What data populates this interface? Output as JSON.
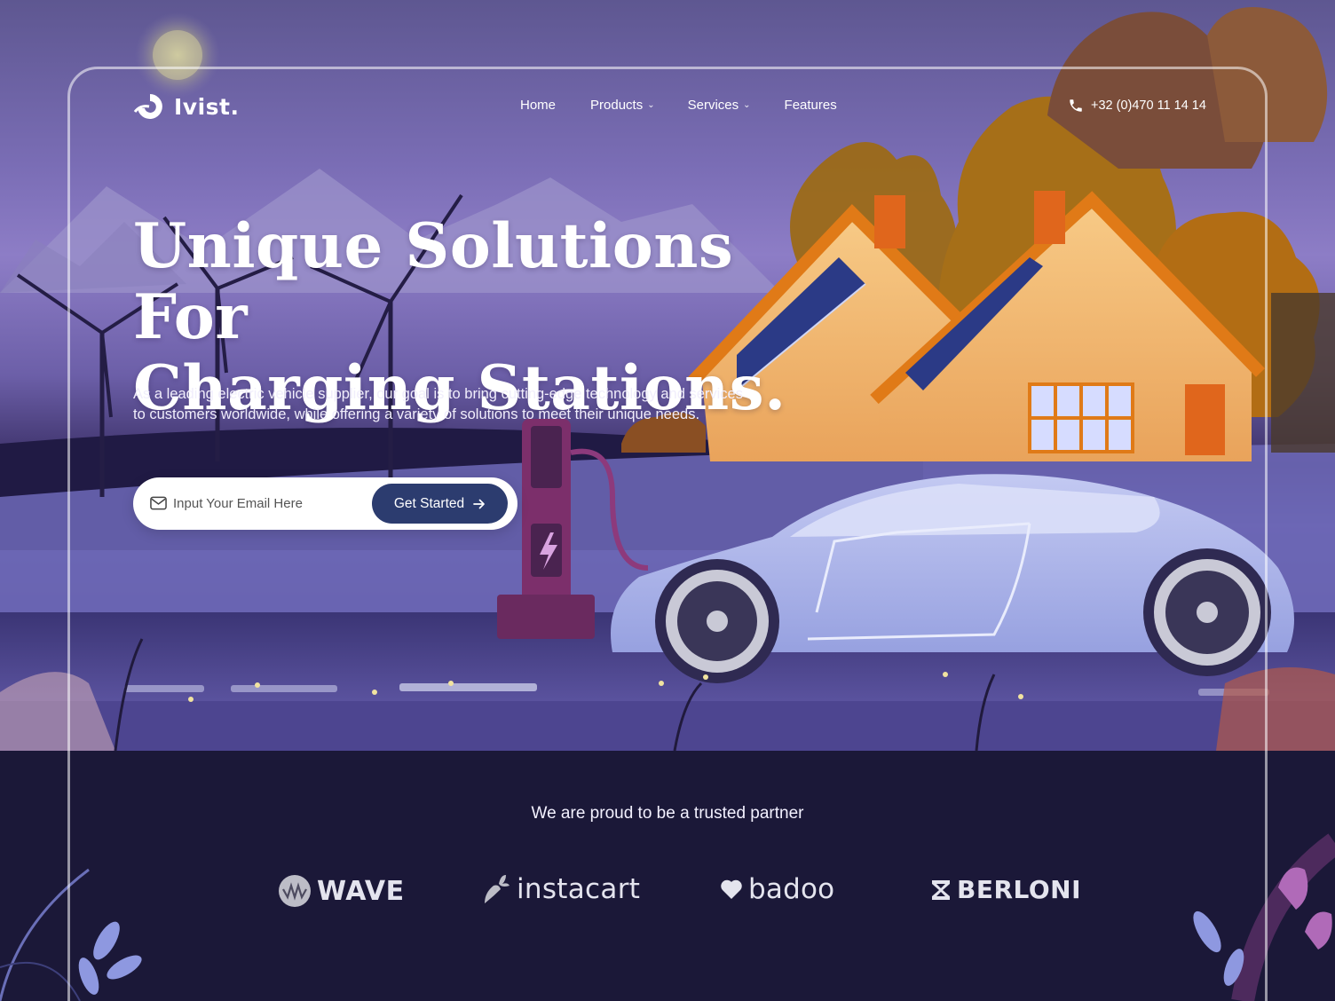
{
  "brand": {
    "name": "Ivist.",
    "logo_icon": "swirl-logo-icon"
  },
  "nav": {
    "items": [
      {
        "label": "Home",
        "has_dropdown": false
      },
      {
        "label": "Products",
        "has_dropdown": true
      },
      {
        "label": "Services",
        "has_dropdown": true
      },
      {
        "label": "Features",
        "has_dropdown": false
      }
    ],
    "phone": "+32 (0)470 11 14 14",
    "phone_icon": "phone-icon"
  },
  "hero": {
    "headline_line1": "Unique Solutions For",
    "headline_line2": "Charging Stations.",
    "subtext": "As a leading electric vehicle supplier, our goal is to bring cutting-edge technology and services to customers worldwide, while offering a variety of solutions to meet their unique needs."
  },
  "signup": {
    "email_placeholder": "Input Your Email Here",
    "email_value": "",
    "cta_label": "Get Started",
    "cta_icon": "arrow-right-icon",
    "input_icon": "mail-icon"
  },
  "partners": {
    "title": "We are proud to be a trusted partner",
    "logos": [
      {
        "name": "WAVE"
      },
      {
        "name": "instacart"
      },
      {
        "name": "badoo"
      },
      {
        "name": "BERLONI"
      }
    ]
  },
  "colors": {
    "primary_button": "#2c3c6f",
    "footer_bg": "#1b1838",
    "sky_purple": "#8d7dc6",
    "house_orange": "#e89a3c",
    "car_lavender": "#aab4ea"
  }
}
